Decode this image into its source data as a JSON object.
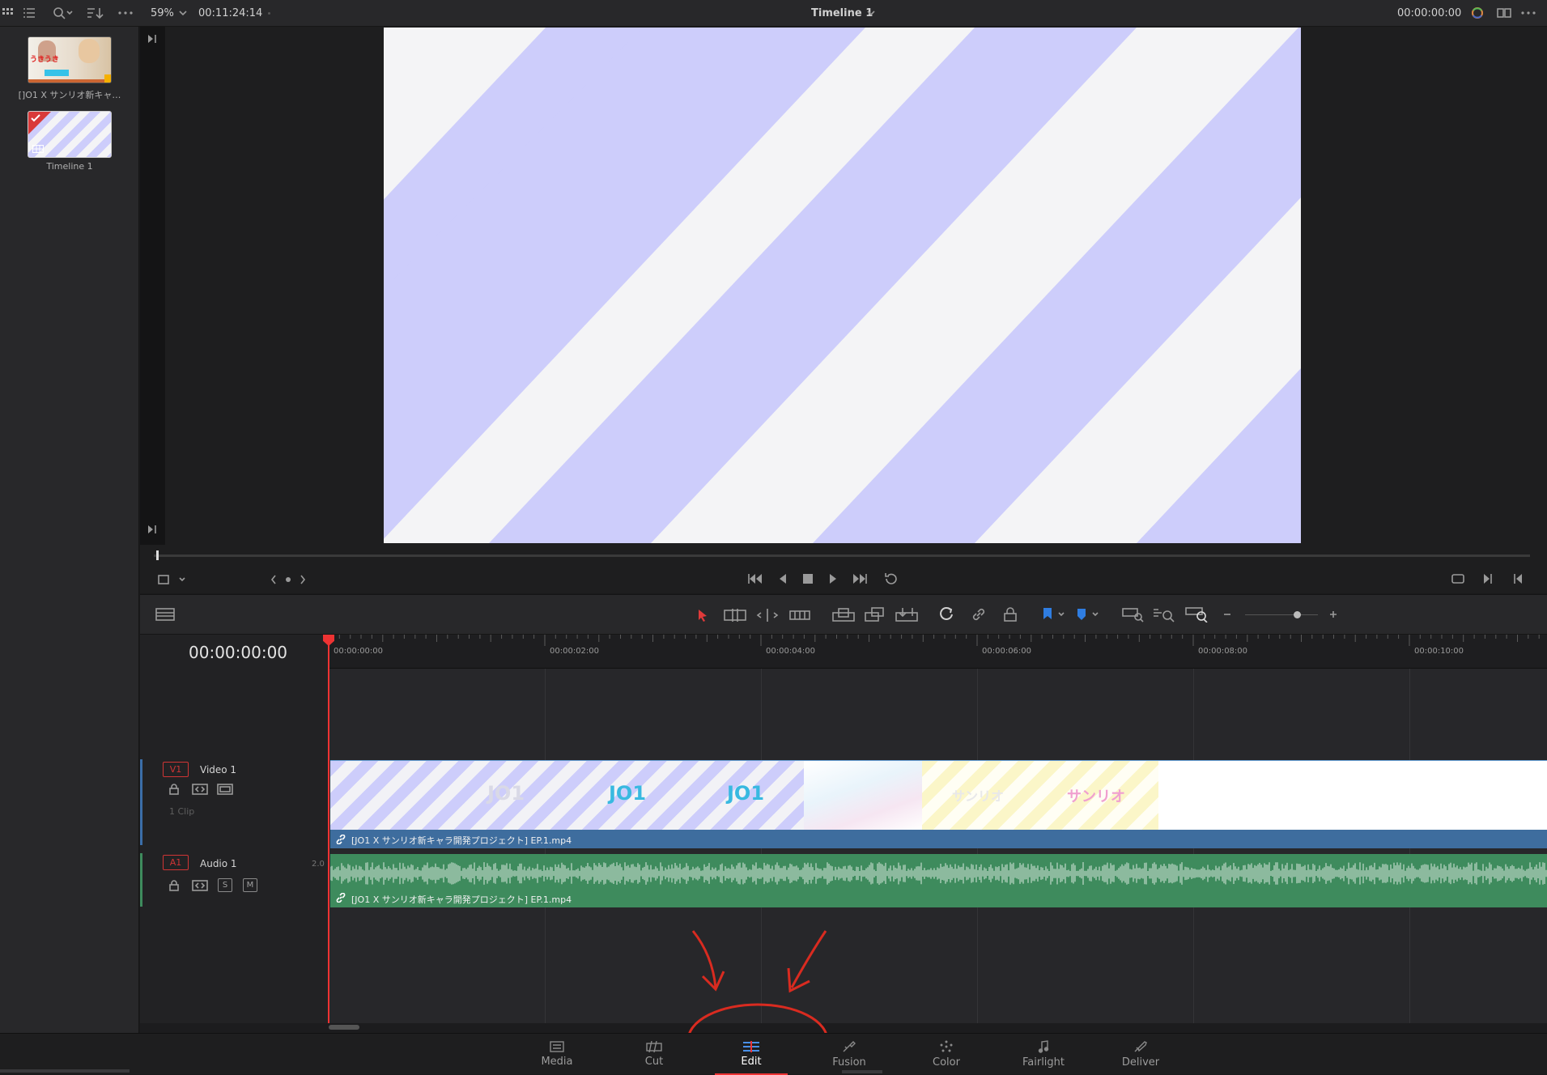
{
  "topbar": {
    "zoom": "59%",
    "source_timecode": "00:11:24:14",
    "timeline_name": "Timeline 1",
    "record_timecode": "00:00:00:00"
  },
  "media_pool": {
    "items": [
      {
        "label": "[]O1 X サンリオ新キャ…",
        "thumb_text": "うきうき"
      },
      {
        "label": "Timeline 1"
      }
    ]
  },
  "timeline": {
    "current_timecode": "00:00:00:00",
    "ruler_ticks": [
      "00:00:00:00",
      "00:00:02:00",
      "00:00:04:00",
      "00:00:06:00",
      "00:00:08:00",
      "00:00:10:00"
    ],
    "video_track": {
      "id": "V1",
      "name": "Video 1",
      "clip_count": "1 Clip",
      "clip_name": "[JO1 X サンリオ新キャラ開発プロジェクト] EP.1.mp4",
      "frame_texts": [
        "JO1",
        "JO1",
        "JO1",
        "サンリオ",
        "サンリオ"
      ]
    },
    "audio_track": {
      "id": "A1",
      "name": "Audio 1",
      "channels": "2.0",
      "solo": "S",
      "mute": "M",
      "clip_name": "[JO1 X サンリオ新キャラ開発プロジェクト] EP.1.mp4"
    }
  },
  "pages": [
    {
      "label": "Media",
      "icon": "media-icon"
    },
    {
      "label": "Cut",
      "icon": "cut-icon"
    },
    {
      "label": "Edit",
      "icon": "edit-icon",
      "active": true
    },
    {
      "label": "Fusion",
      "icon": "fusion-icon"
    },
    {
      "label": "Color",
      "icon": "color-icon"
    },
    {
      "label": "Fairlight",
      "icon": "fairlight-icon"
    },
    {
      "label": "Deliver",
      "icon": "deliver-icon"
    }
  ],
  "colors": {
    "accent": "#e33333",
    "video_clip": "#3e6d9e",
    "audio_clip": "#3e8b5d",
    "stripe": "#cdcdfb"
  }
}
